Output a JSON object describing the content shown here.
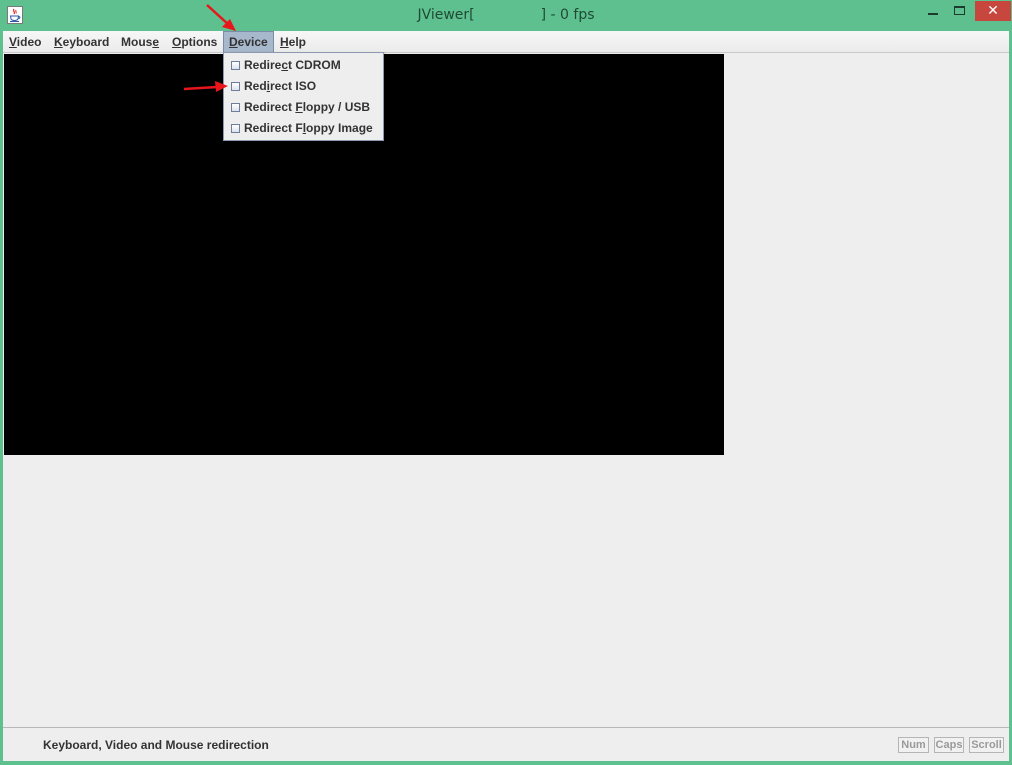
{
  "window": {
    "title_prefix": "JViewer[",
    "title_suffix": "] - 0 fps",
    "close_glyph": "✕",
    "accent_color": "#5fc08f",
    "close_color": "#c7463d"
  },
  "menubar": {
    "items": [
      {
        "label_pre": "",
        "mnemonic": "V",
        "label_post": "ideo"
      },
      {
        "label_pre": "",
        "mnemonic": "K",
        "label_post": "eyboard"
      },
      {
        "label_pre": "Mous",
        "mnemonic": "e",
        "label_post": ""
      },
      {
        "label_pre": "",
        "mnemonic": "O",
        "label_post": "ptions"
      },
      {
        "label_pre": "",
        "mnemonic": "D",
        "label_post": "evice"
      },
      {
        "label_pre": "",
        "mnemonic": "H",
        "label_post": "elp"
      }
    ],
    "active": "Device"
  },
  "device_menu": {
    "items": [
      {
        "label_pre": "Redire",
        "mnemonic": "c",
        "label_post": "t CDROM",
        "checked": false
      },
      {
        "label_pre": "Red",
        "mnemonic": "i",
        "label_post": "rect ISO",
        "checked": false
      },
      {
        "label_pre": "Redirect ",
        "mnemonic": "F",
        "label_post": "loppy / USB",
        "checked": false
      },
      {
        "label_pre": "Redirect F",
        "mnemonic": "l",
        "label_post": "oppy Image",
        "checked": false
      }
    ]
  },
  "statusbar": {
    "message": "Keyboard, Video and Mouse redirection",
    "num_label": "Num",
    "caps_label": "Caps",
    "scroll_label": "Scroll"
  },
  "annotations": {
    "arrow_color": "#e8151b"
  }
}
